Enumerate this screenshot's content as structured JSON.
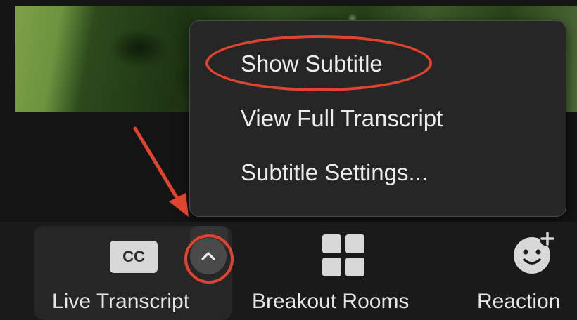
{
  "menu": {
    "items": [
      {
        "label": "Show Subtitle"
      },
      {
        "label": "View Full Transcript"
      },
      {
        "label": "Subtitle Settings..."
      }
    ]
  },
  "toolbar": {
    "live_transcript": {
      "icon_text": "CC",
      "label": "Live Transcript"
    },
    "breakout_rooms": {
      "label": "Breakout Rooms"
    },
    "reactions": {
      "label": "Reaction"
    }
  },
  "icons": {
    "cc": "closed-captions-icon",
    "caret": "chevron-up-icon",
    "breakout": "grid-icon",
    "reactions": "smiley-plus-icon"
  },
  "colors": {
    "annotation": "#e0442e",
    "menu_bg": "#262626",
    "toolbar_bg": "#1a1a1a"
  }
}
